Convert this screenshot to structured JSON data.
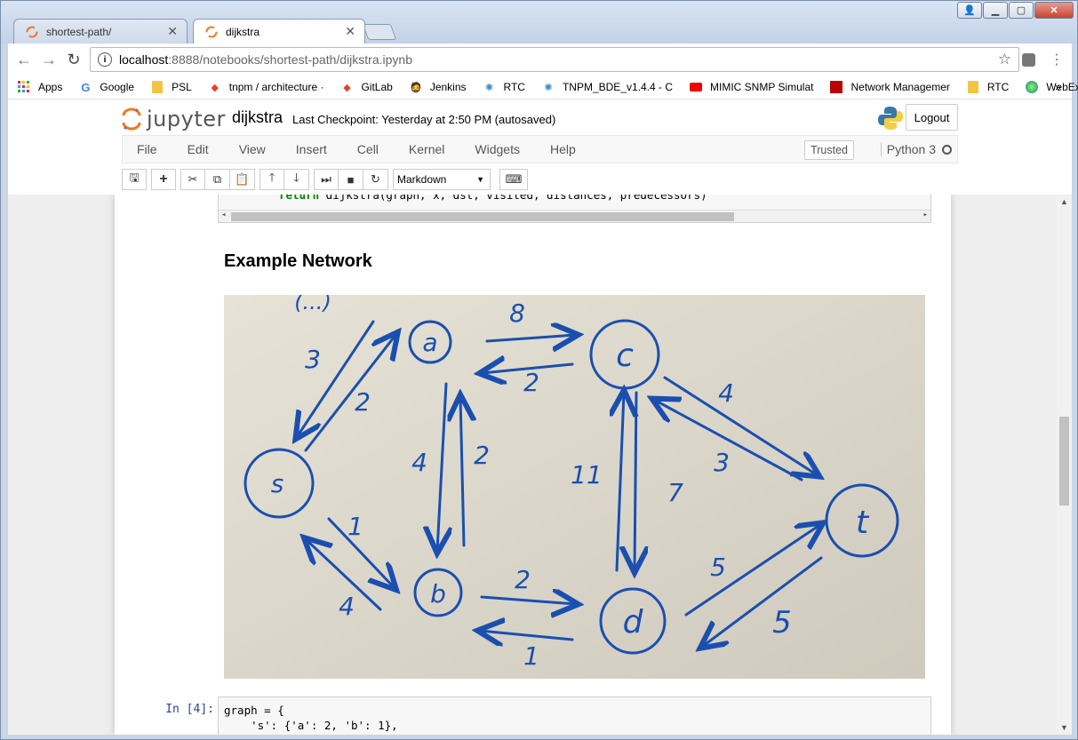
{
  "tabs": [
    {
      "label": "shortest-path/"
    },
    {
      "label": "dijkstra"
    }
  ],
  "url": {
    "host": "localhost",
    "rest": ":8888/notebooks/shortest-path/dijkstra.ipynb"
  },
  "bookmarks": [
    "Apps",
    "Google",
    "PSL",
    "tnpm / architecture ·",
    "GitLab",
    "Jenkins",
    "RTC",
    "TNPM_BDE_v1.4.4 - C",
    "MIMIC SNMP Simulat",
    "Network Managemer",
    "RTC",
    "WebEx"
  ],
  "jupyter": {
    "logo_text": "jupyter",
    "notebook_name": "dijkstra",
    "checkpoint": "Last Checkpoint: Yesterday at 2:50 PM (autosaved)",
    "logout": "Logout"
  },
  "menu": [
    "File",
    "Edit",
    "View",
    "Insert",
    "Cell",
    "Kernel",
    "Widgets",
    "Help"
  ],
  "trusted": "Trusted",
  "kernel": "Python 3",
  "cell_type": "Markdown",
  "code_preview": {
    "keyword": "return",
    "rest": " dijkstra(graph, x, dst, visited, distances, predecessors)"
  },
  "heading": "Example Network",
  "photo": {
    "labels": [
      "(...)",
      "a",
      "c",
      "s",
      "t",
      "b",
      "d",
      "8",
      "2",
      "3",
      "2",
      "4",
      "2",
      "11",
      "7",
      "4",
      "3",
      "1",
      "4",
      "2",
      "1",
      "5",
      "5"
    ]
  },
  "input_prompt": "In [4]:",
  "code_lines": [
    "graph = {",
    "    's': {'a': 2, 'b': 1},"
  ],
  "colors": {
    "ink": "#1a4fb0",
    "paper": "#dcd8cc"
  }
}
